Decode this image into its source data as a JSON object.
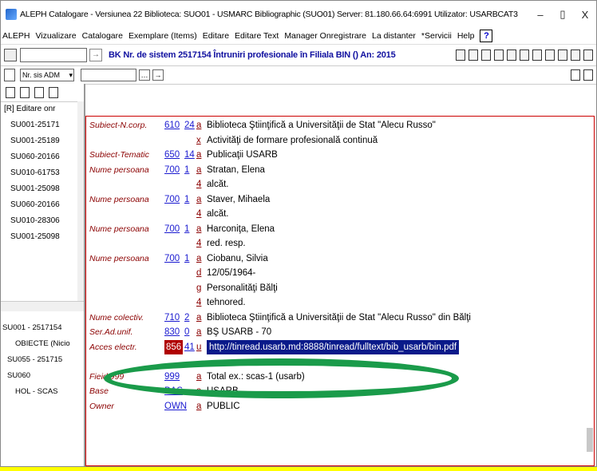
{
  "window": {
    "title": "ALEPH Catalogare - Versiunea 22  Biblioteca:  SUO01 - USMARC Bibliographic (SUO01)  Server:  81.180.66.64:6991  Utilizator:  USARBCAT3",
    "minimize": "–",
    "maximize": "▯",
    "close": "X"
  },
  "menu": [
    "ALEPH",
    "Vizualizare",
    "Catalogare",
    "Exemplare (Items)",
    "Editare",
    "Editare Text",
    "Manager Onregistrare",
    "La distanter",
    "*Servicii",
    "Help"
  ],
  "menu_help_glyph": "?",
  "toolbar": {
    "doc_title": "BK Nr. de sistem 2517154 Întruniri profesionale în Filiala BIN () An: 2015",
    "base_select": "Nr. sis ADM"
  },
  "left_tree": {
    "root": "[R] Editare onr",
    "items": [
      "SU001-25171",
      "SU001-25189",
      "SU060-20166",
      "SU010-61753",
      "SU001-25098",
      "SU060-20166",
      "SU010-28306",
      "SU001-25098"
    ]
  },
  "left_tree2": {
    "items": [
      "SU001 - 2517154",
      "OBIECTE (Nicio",
      "SU055 - 251715",
      "SU060",
      "HOL - SCAS"
    ]
  },
  "record": [
    {
      "label": "Subiect-N.corp.",
      "tag": "610",
      "ind": "24",
      "sub": "a",
      "value": "Biblioteca Ştiinţifică a Universităţii de Stat \"Alecu Russo\""
    },
    {
      "label": "",
      "tag": "",
      "ind": "",
      "sub": "x",
      "value": "Activităţi de formare profesională continuă"
    },
    {
      "label": "Subiect-Tematic",
      "tag": "650",
      "ind": "14",
      "sub": "a",
      "value": "Publicaţii USARB"
    },
    {
      "label": "Nume persoana",
      "tag": "700",
      "ind": "1",
      "sub": "a",
      "value": "Stratan, Elena"
    },
    {
      "label": "",
      "tag": "",
      "ind": "",
      "sub": "4",
      "value": "alcăt."
    },
    {
      "label": "Nume persoana",
      "tag": "700",
      "ind": "1",
      "sub": "a",
      "value": "Staver, Mihaela"
    },
    {
      "label": "",
      "tag": "",
      "ind": "",
      "sub": "4",
      "value": "alcăt."
    },
    {
      "label": "Nume persoana",
      "tag": "700",
      "ind": "1",
      "sub": "a",
      "value": "Harconiţa, Elena"
    },
    {
      "label": "",
      "tag": "",
      "ind": "",
      "sub": "4",
      "value": "red. resp."
    },
    {
      "label": "Nume persoana",
      "tag": "700",
      "ind": "1",
      "sub": "a",
      "value": "Ciobanu, Silvia"
    },
    {
      "label": "",
      "tag": "",
      "ind": "",
      "sub": "d",
      "value": "12/05/1964-"
    },
    {
      "label": "",
      "tag": "",
      "ind": "",
      "sub": "g",
      "value": "Personalităţi Bălţi"
    },
    {
      "label": "",
      "tag": "",
      "ind": "",
      "sub": "4",
      "value": "tehnored."
    },
    {
      "label": "Nume colectiv.",
      "tag": "710",
      "ind": "2",
      "sub": "a",
      "value": "Biblioteca Ştiinţifică a Universităţii de Stat \"Alecu Russo\" din Bălţi"
    },
    {
      "label": "Ser.Ad.unif.",
      "tag": "830",
      "ind": "0",
      "sub": "a",
      "value": "BŞ USARB - 70"
    },
    {
      "label": "Acces electr.",
      "tag": "856",
      "ind": "41",
      "sub": "u",
      "value": "http://tinread.usarb.md:8888/tinread/fulltext/bib_usarb/bin.pdf",
      "highlight": true
    },
    {
      "label": "",
      "tag": "",
      "ind": "",
      "sub": "",
      "value": ""
    },
    {
      "label": "Fieid 999",
      "tag": "999",
      "ind": "",
      "sub": "a",
      "value": "Total ex.: scas-1 (usarb)"
    },
    {
      "label": "Base",
      "tag": "BAS",
      "ind": "",
      "sub": "a",
      "value": "USARB"
    },
    {
      "label": "Owner",
      "tag": "OWN",
      "ind": "",
      "sub": "a",
      "value": "PUBLIC"
    }
  ],
  "colors": {
    "border_yellow": "#ffff00",
    "ellipse_green": "#1a9b4a",
    "tag_blue": "#1a1ad0",
    "label_red": "#8b0000",
    "url_bg": "#0a1a8a"
  }
}
